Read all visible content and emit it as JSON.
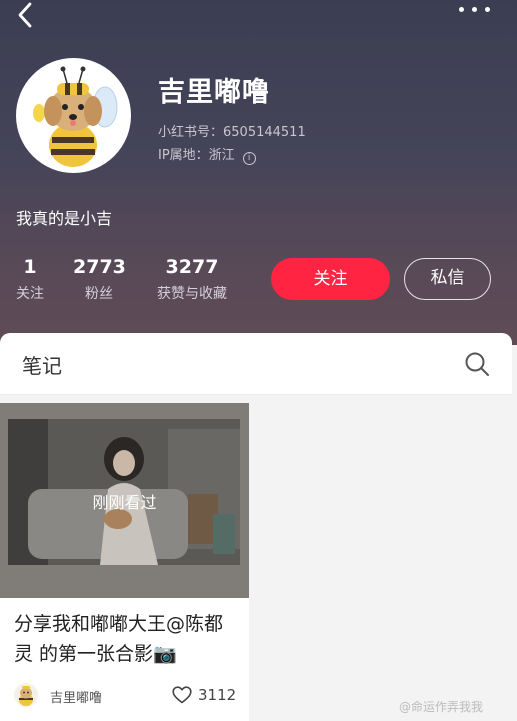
{
  "profile": {
    "name": "吉里嘟噜",
    "xhs_id": "小红书号：6505144511",
    "ip_location": "IP属地：浙江",
    "bio": "我真的是小吉"
  },
  "stats": [
    {
      "value": "1",
      "label": "关注"
    },
    {
      "value": "2773",
      "label": "粉丝"
    },
    {
      "value": "3277",
      "label": "获赞与收藏"
    }
  ],
  "actions": {
    "follow": "关注",
    "message": "私信"
  },
  "tabs": {
    "notes": "笔记"
  },
  "notes": [
    {
      "seen_label": "刚刚看过",
      "title": "分享我和嘟嘟大王@陈都灵 的第一张合影📷",
      "author": "吉里嘟噜",
      "likes": "3112"
    }
  ],
  "watermark": "@命运作弄我我",
  "colors": {
    "accent": "#ff2442"
  },
  "icons": [
    "back-icon",
    "more-icon",
    "info-icon",
    "search-icon",
    "heart-icon",
    "camera-emoji"
  ]
}
